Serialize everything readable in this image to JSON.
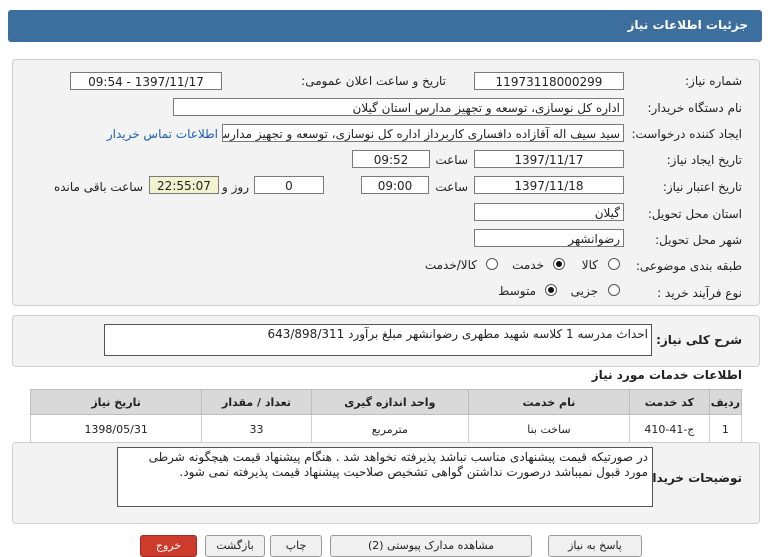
{
  "header": {
    "title": "جزئیات اطلاعات نیاز"
  },
  "fields": {
    "need_number_label": "شماره نیاز:",
    "need_number": "11973118000299",
    "announce_label": "تاریخ و ساعت اعلان عمومی:",
    "announce_value": "1397/11/17 - 09:54",
    "buyer_label": "نام دستگاه خریدار:",
    "buyer": "اداره کل نوسازی، توسعه و تجهیز مدارس استان گیلان",
    "creator_label": "ایجاد کننده درخواست:",
    "creator": "سید سیف اله آقازاده دافساری کاربرداز اداره کل نوسازی، توسعه و تجهیز مدارس",
    "contact_link": "اطلاعات تماس خریدار",
    "created_date_label": "تاریخ ایجاد نیاز:",
    "created_date": "1397/11/17",
    "time_label": "ساعت",
    "created_time": "09:52",
    "validity_label": "تاریخ اعتبار نیاز:",
    "validity_date": "1397/11/18",
    "validity_time": "09:00",
    "days": "0",
    "days_label": "روز و",
    "remaining": "22:55:07",
    "remaining_label": "ساعت باقی مانده",
    "province_label": "استان محل تحویل:",
    "province": "گیلان",
    "city_label": "شهر محل تحویل:",
    "city": "رضوانشهر",
    "category_label": "طبقه بندی موضوعی:",
    "category_options": [
      "کالا",
      "خدمت",
      "کالا/خدمت"
    ],
    "category_selected": "خدمت",
    "process_label": "نوع فرآیند خرید :",
    "process_options": [
      "جزیی",
      "متوسط"
    ],
    "process_selected": "متوسط"
  },
  "description": {
    "label": "شرح کلی نیاز:",
    "text": "احداث مدرسه 1 کلاسه شهید مطهری رضوانشهر مبلغ برآورد 643/898/311"
  },
  "services": {
    "section_title": "اطلاعات خدمات مورد نیاز",
    "columns": [
      "ردیف",
      "کد خدمت",
      "نام خدمت",
      "واحد اندازه گیری",
      "تعداد / مقدار",
      "تاریخ نیاز"
    ],
    "rows": [
      [
        "1",
        "ج-41-410",
        "ساخت بنا",
        "مترمربع",
        "33",
        "1398/05/31"
      ]
    ]
  },
  "notes": {
    "label": "توضیحات خریدار:",
    "text": "در صورتیکه قیمت پیشنهادی مناسب نباشد پذیرفته نخواهد شد . هنگام پیشنهاد قیمت هیچگونه شرطی مورد قبول نمیباشد  درصورت نداشتن گواهی تشخیص صلاحیت پیشنهاد قیمت پذیرفته نمی شود."
  },
  "buttons": {
    "reply": "پاسخ به نیاز",
    "attachments": "مشاهده مدارک پیوستی (2)",
    "print": "چاپ",
    "back": "بازگشت",
    "exit": "خروج"
  }
}
